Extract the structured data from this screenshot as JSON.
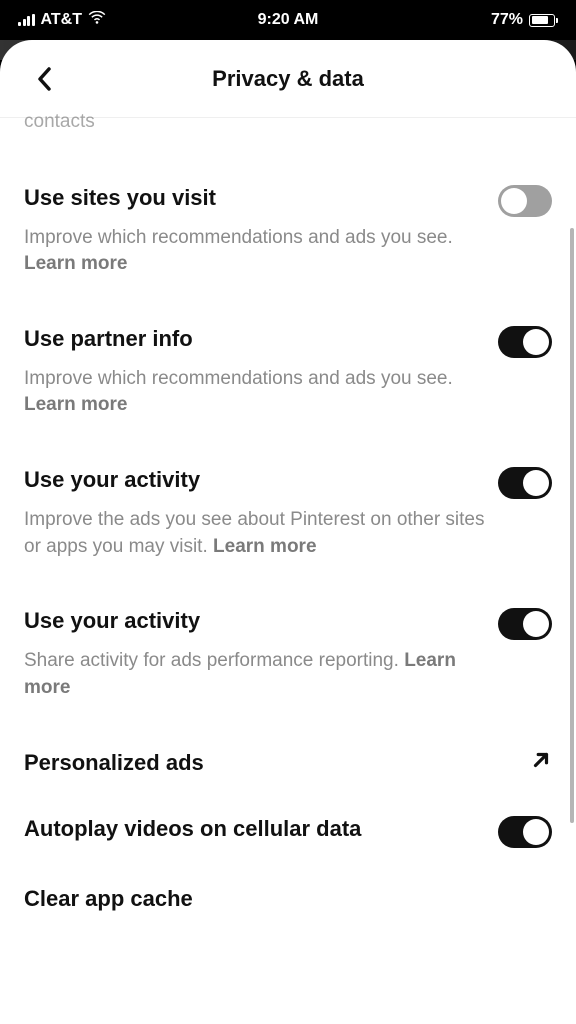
{
  "status_bar": {
    "carrier": "AT&T",
    "time": "9:20 AM",
    "battery_pct": "77%"
  },
  "header": {
    "title": "Privacy & data"
  },
  "cut_off_text": "contacts",
  "settings": [
    {
      "title": "Use sites you visit",
      "desc": "Improve which recommendations and ads you see. ",
      "learn_more": "Learn more",
      "toggle": false,
      "has_desc": true,
      "has_toggle": true
    },
    {
      "title": "Use partner info",
      "desc": "Improve which recommendations and ads you see. ",
      "learn_more": "Learn more",
      "toggle": true,
      "has_desc": true,
      "has_toggle": true
    },
    {
      "title": "Use your activity",
      "desc": "Improve the ads you see about Pinterest on other sites or apps you may visit. ",
      "learn_more": "Learn more",
      "toggle": true,
      "has_desc": true,
      "has_toggle": true
    },
    {
      "title": "Use your activity",
      "desc": "Share activity for ads performance reporting. ",
      "learn_more": "Learn more",
      "toggle": true,
      "has_desc": true,
      "has_toggle": true
    }
  ],
  "link_row": {
    "title": "Personalized ads"
  },
  "autoplay_row": {
    "title": "Autoplay videos on cellular data",
    "toggle": true
  },
  "clear_cache": {
    "title": "Clear app cache"
  }
}
